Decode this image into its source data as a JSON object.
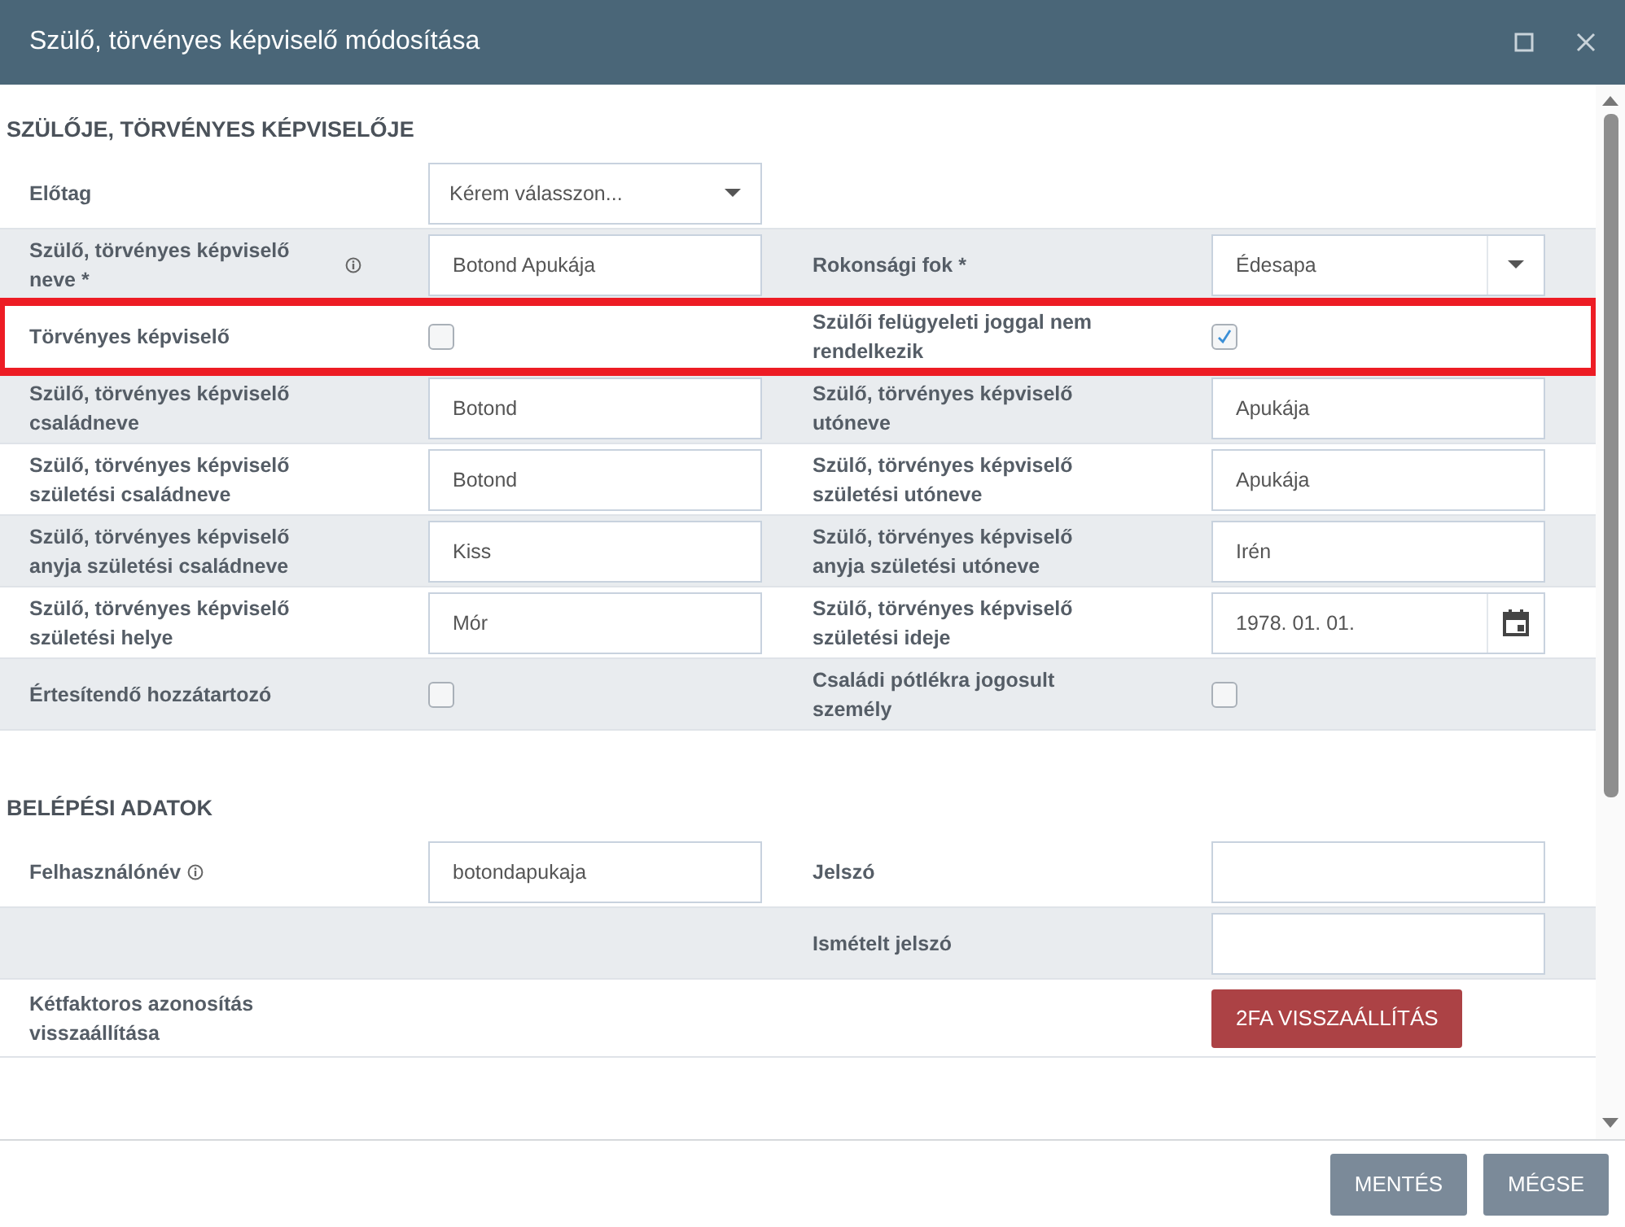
{
  "dialog": {
    "title": "Szülő, törvényes képviselő módosítása"
  },
  "sections": [
    {
      "title": "SZÜLŐJE, TÖRVÉNYES KÉPVISELŐJE",
      "rows": [
        {
          "highlighted": false,
          "left": {
            "label": "Előtag",
            "field": {
              "kind": "select",
              "placeholder": "Kérem válasszon..."
            }
          }
        },
        {
          "highlighted": false,
          "left": {
            "label": "Szülő, törvényes képviselő neve *",
            "info": true,
            "field": {
              "kind": "text",
              "value": "Botond Apukája"
            }
          },
          "right": {
            "label": "Rokonsági fok *",
            "field": {
              "kind": "select",
              "value": "Édesapa"
            }
          }
        },
        {
          "highlighted": true,
          "left": {
            "label": "Törvényes képviselő",
            "field": {
              "kind": "checkbox",
              "checked": false
            }
          },
          "right": {
            "label": "Szülői felügyeleti joggal nem rendelkezik",
            "field": {
              "kind": "checkbox",
              "checked": true
            }
          }
        },
        {
          "highlighted": false,
          "left": {
            "label": "Szülő, törvényes képviselő családneve",
            "field": {
              "kind": "text",
              "value": "Botond"
            }
          },
          "right": {
            "label": "Szülő, törvényes képviselő utóneve",
            "field": {
              "kind": "text",
              "value": "Apukája"
            }
          }
        },
        {
          "highlighted": false,
          "left": {
            "label": "Szülő, törvényes képviselő születési családneve",
            "field": {
              "kind": "text",
              "value": "Botond"
            }
          },
          "right": {
            "label": "Szülő, törvényes képviselő születési utóneve",
            "field": {
              "kind": "text",
              "value": "Apukája"
            }
          }
        },
        {
          "highlighted": false,
          "left": {
            "label": "Szülő, törvényes képviselő anyja születési családneve",
            "field": {
              "kind": "text",
              "value": "Kiss"
            }
          },
          "right": {
            "label": "Szülő, törvényes képviselő anyja születési utóneve",
            "field": {
              "kind": "text",
              "value": "Irén"
            }
          }
        },
        {
          "highlighted": false,
          "left": {
            "label": "Szülő, törvényes képviselő születési helye",
            "field": {
              "kind": "text",
              "value": "Mór"
            }
          },
          "right": {
            "label": "Szülő, törvényes képviselő születési ideje",
            "field": {
              "kind": "date",
              "value": "1978. 01. 01."
            }
          }
        },
        {
          "highlighted": false,
          "left": {
            "label": "Értesítendő hozzátartozó",
            "field": {
              "kind": "checkbox",
              "checked": false
            }
          },
          "right": {
            "label": "Családi pótlékra jogosult személy",
            "field": {
              "kind": "checkbox",
              "checked": false
            }
          }
        }
      ]
    },
    {
      "title": "BELÉPÉSI ADATOK",
      "rows": [
        {
          "highlighted": false,
          "left": {
            "label": "Felhasználónév",
            "info": true,
            "field": {
              "kind": "text",
              "value": "botondapukaja"
            }
          },
          "right": {
            "label": "Jelszó",
            "field": {
              "kind": "password"
            }
          }
        },
        {
          "highlighted": false,
          "right": {
            "label": "Ismételt jelszó",
            "field": {
              "kind": "password"
            }
          }
        },
        {
          "highlighted": false,
          "left": {
            "label": "Kétfaktoros azonosítás visszaállítása"
          },
          "right": {
            "field": {
              "kind": "button",
              "label": "2FA VISSZAÁLLÍTÁS"
            }
          }
        }
      ]
    }
  ],
  "footer": {
    "buttons": [
      {
        "label": "MENTÉS"
      },
      {
        "label": "MÉGSE"
      }
    ]
  }
}
